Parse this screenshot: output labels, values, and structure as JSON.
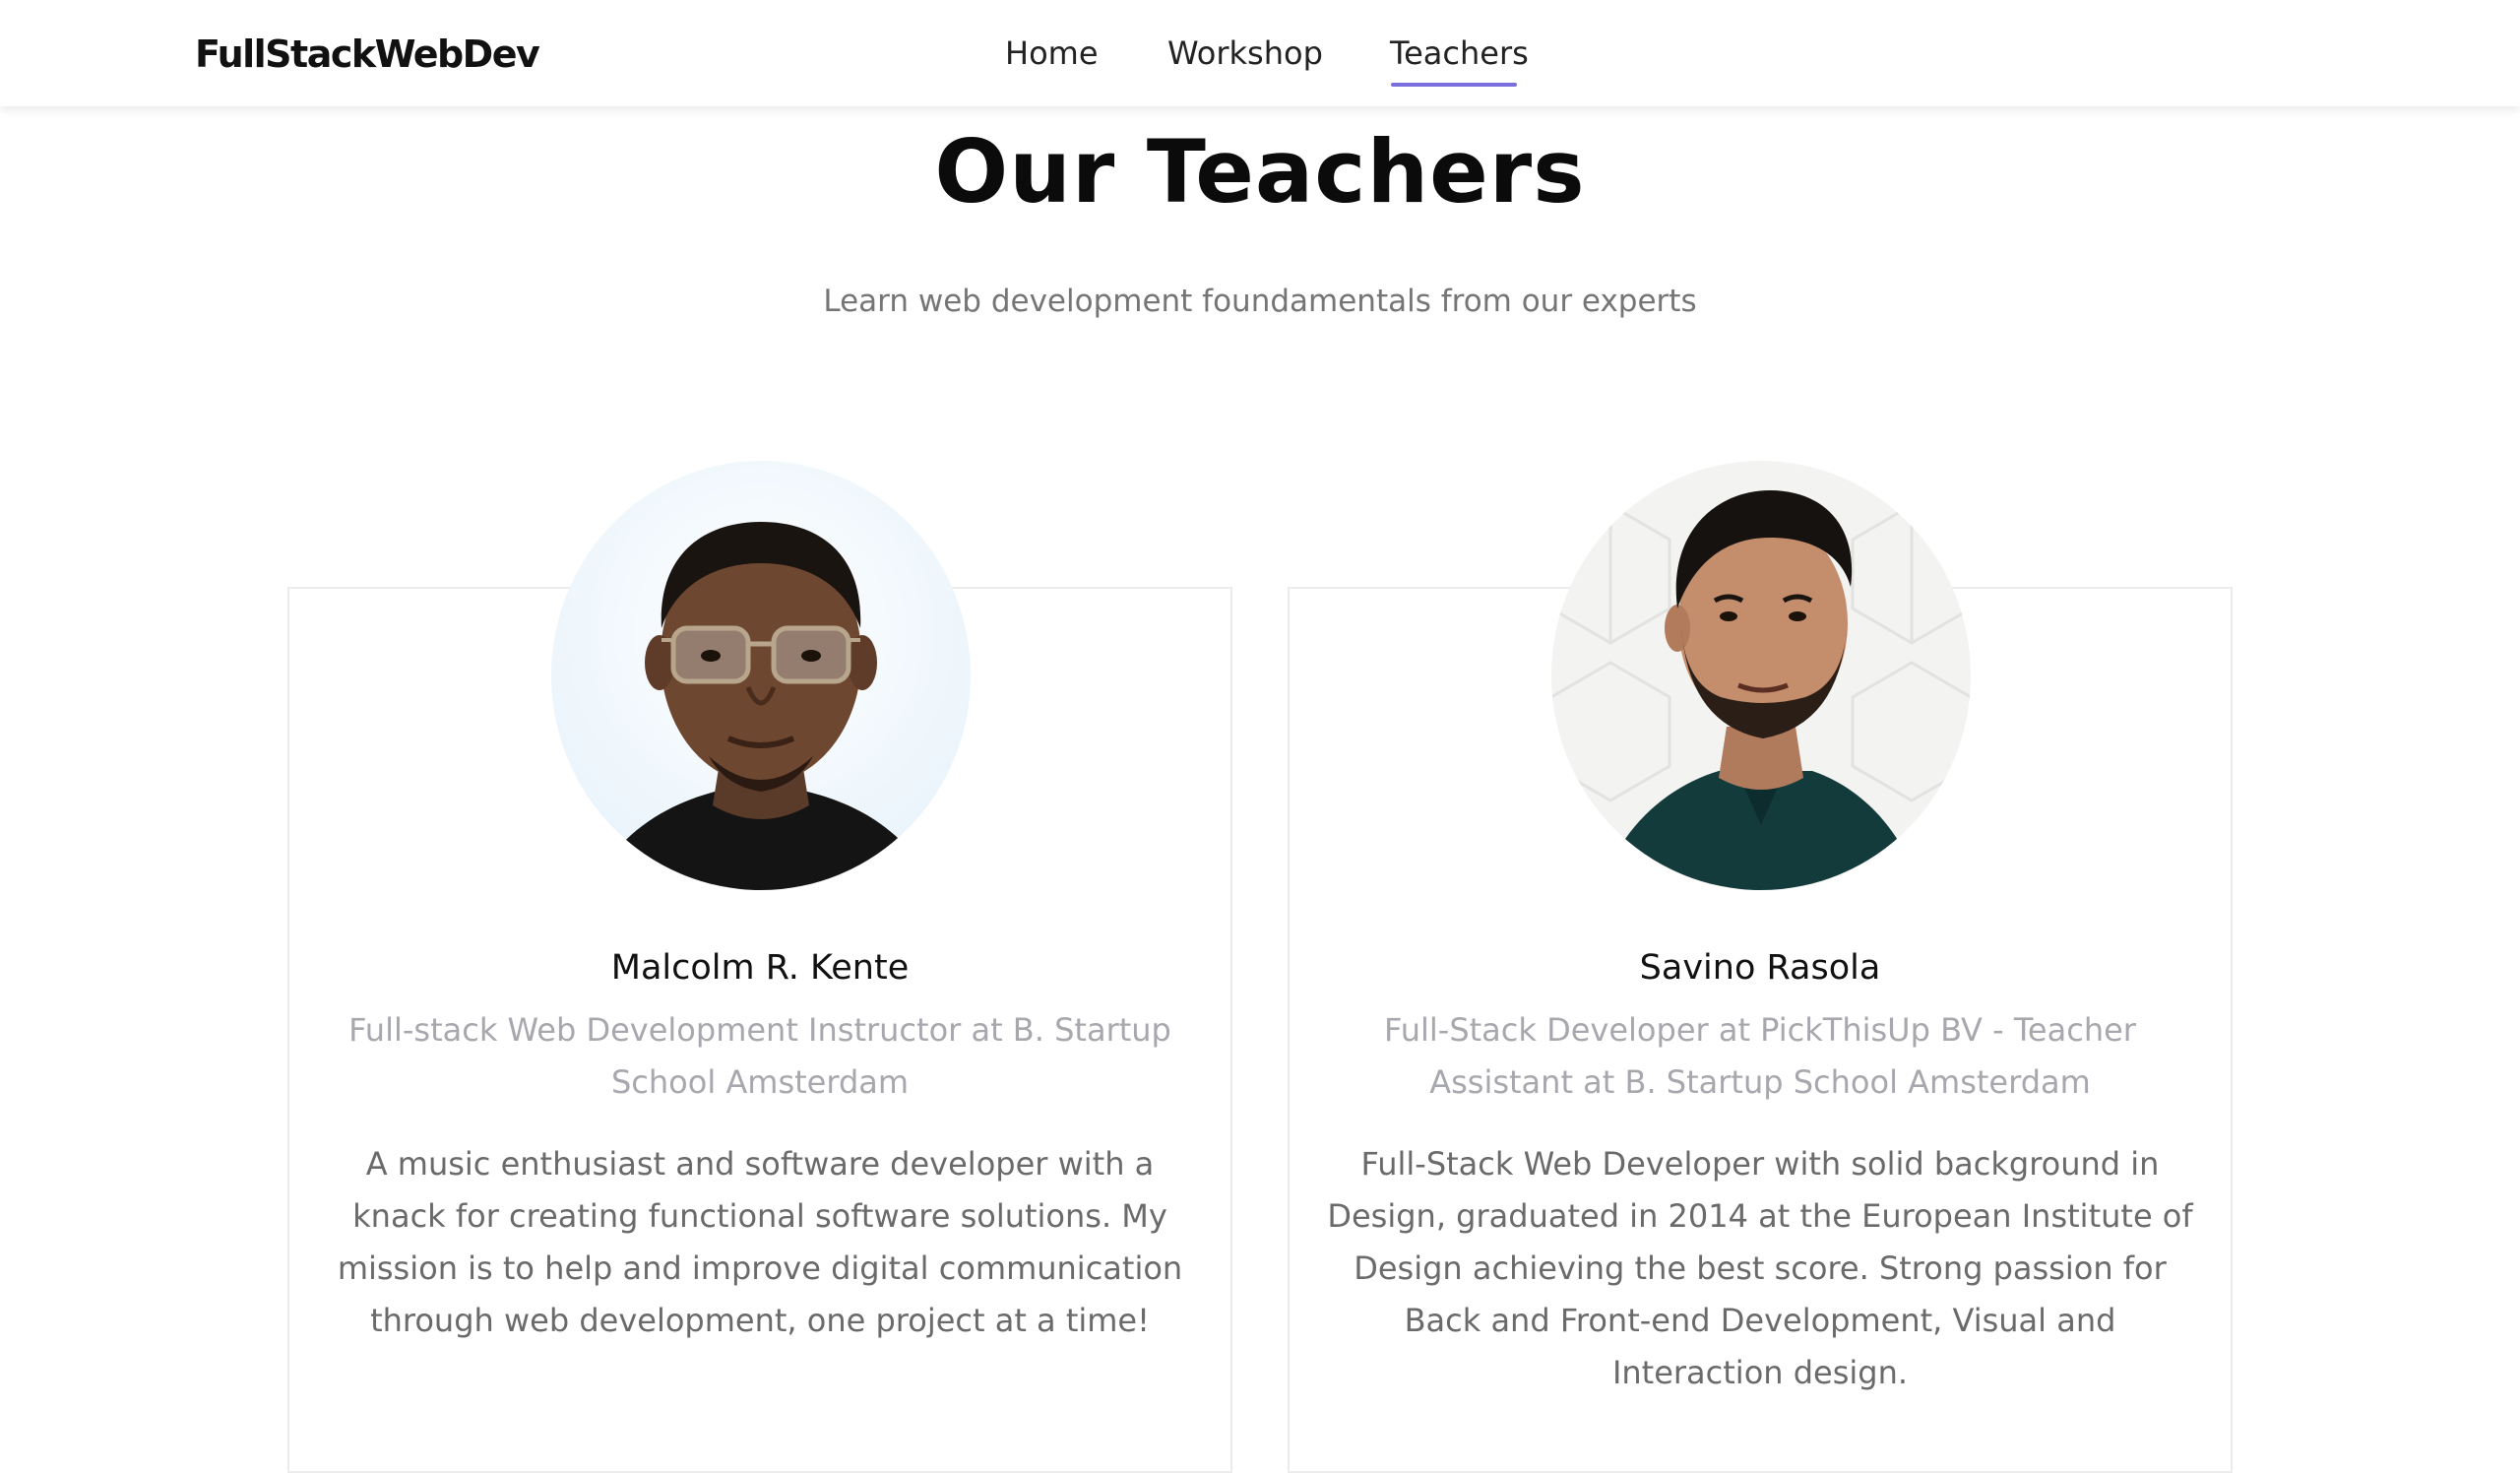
{
  "header": {
    "brand": "FullStackWebDev",
    "nav": [
      {
        "label": "Home",
        "active": false
      },
      {
        "label": "Workshop",
        "active": false
      },
      {
        "label": "Teachers",
        "active": true
      }
    ],
    "active_color": "#7b6fe0"
  },
  "main": {
    "title": "Our Teachers",
    "subtitle": "Learn web development foundamentals from our experts"
  },
  "teachers": [
    {
      "name": "Malcolm R. Kente",
      "role": "Full-stack Web Development Instructor at B. Startup School Amsterdam",
      "bio": "A music enthusiast and software developer with a knack for creating functional software solutions. My mission is to help and improve digital communication through web development, one project at a time!",
      "photo_icon": "portrait-photo"
    },
    {
      "name": "Savino Rasola",
      "role": "Full-Stack Developer at PickThisUp BV - Teacher Assistant at B. Startup School Amsterdam",
      "bio": "Full-Stack Web Developer with solid background in Design, graduated in 2014 at the European Institute of Design achieving the best score. Strong passion for Back and Front-end Development, Visual and Interaction design.",
      "photo_icon": "portrait-photo"
    }
  ]
}
